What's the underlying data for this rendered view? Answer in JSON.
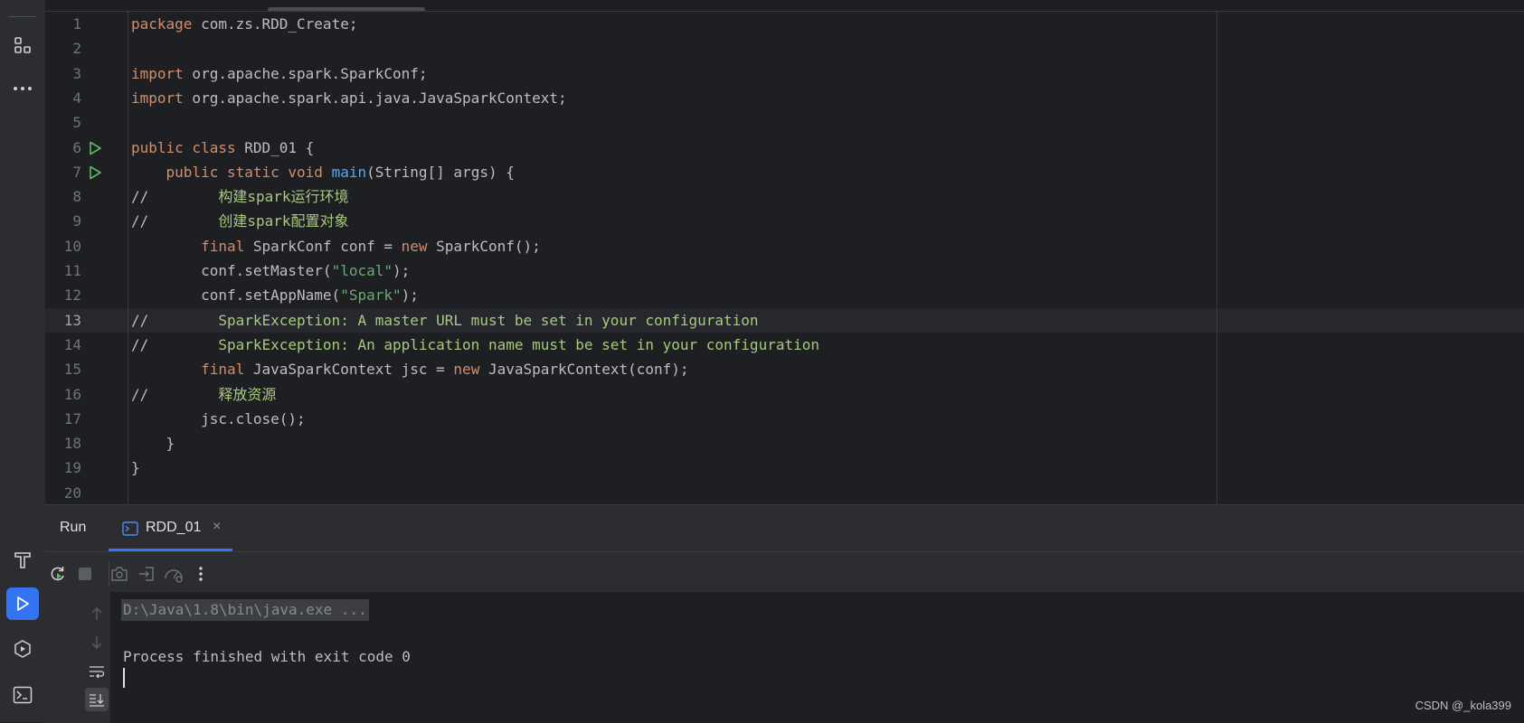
{
  "editor": {
    "lines": [
      {
        "n": "1",
        "tokens": [
          {
            "t": "package",
            "c": "kw"
          },
          {
            "t": " com.zs.RDD_Create;",
            "c": ""
          }
        ]
      },
      {
        "n": "2",
        "tokens": []
      },
      {
        "n": "3",
        "tokens": [
          {
            "t": "import",
            "c": "kw"
          },
          {
            "t": " org.apache.spark.SparkConf;",
            "c": ""
          }
        ]
      },
      {
        "n": "4",
        "tokens": [
          {
            "t": "import",
            "c": "kw"
          },
          {
            "t": " org.apache.spark.api.java.JavaSparkContext;",
            "c": ""
          }
        ]
      },
      {
        "n": "5",
        "tokens": []
      },
      {
        "n": "6",
        "run": true,
        "tokens": [
          {
            "t": "public class",
            "c": "kw"
          },
          {
            "t": " RDD_01 {",
            "c": ""
          }
        ]
      },
      {
        "n": "7",
        "run": true,
        "tokens": [
          {
            "t": "    ",
            "c": ""
          },
          {
            "t": "public static void",
            "c": "kw"
          },
          {
            "t": " ",
            "c": ""
          },
          {
            "t": "main",
            "c": "fn"
          },
          {
            "t": "(String[] args) {",
            "c": ""
          }
        ]
      },
      {
        "n": "8",
        "tokens": [
          {
            "t": "//",
            "c": ""
          },
          {
            "t": "        构建spark运行环境",
            "c": "cmt"
          }
        ]
      },
      {
        "n": "9",
        "tokens": [
          {
            "t": "//",
            "c": ""
          },
          {
            "t": "        创建spark配置对象",
            "c": "cmt"
          }
        ]
      },
      {
        "n": "10",
        "tokens": [
          {
            "t": "        ",
            "c": ""
          },
          {
            "t": "final",
            "c": "kw"
          },
          {
            "t": " SparkConf conf = ",
            "c": ""
          },
          {
            "t": "new",
            "c": "kw"
          },
          {
            "t": " SparkConf();",
            "c": ""
          }
        ]
      },
      {
        "n": "11",
        "tokens": [
          {
            "t": "        conf.setMaster(",
            "c": ""
          },
          {
            "t": "\"local\"",
            "c": "str"
          },
          {
            "t": ");",
            "c": ""
          }
        ]
      },
      {
        "n": "12",
        "tokens": [
          {
            "t": "        conf.setAppName(",
            "c": ""
          },
          {
            "t": "\"Spark\"",
            "c": "str"
          },
          {
            "t": ");",
            "c": ""
          }
        ]
      },
      {
        "n": "13",
        "current": true,
        "tokens": [
          {
            "t": "//",
            "c": ""
          },
          {
            "t": "        SparkException: A master URL must be set in your configuration",
            "c": "cmt"
          }
        ]
      },
      {
        "n": "14",
        "tokens": [
          {
            "t": "//",
            "c": ""
          },
          {
            "t": "        SparkException: An application name must be set in your configuration",
            "c": "cmt"
          }
        ]
      },
      {
        "n": "15",
        "tokens": [
          {
            "t": "        ",
            "c": ""
          },
          {
            "t": "final",
            "c": "kw"
          },
          {
            "t": " JavaSparkContext jsc = ",
            "c": ""
          },
          {
            "t": "new",
            "c": "kw"
          },
          {
            "t": " JavaSparkContext(conf);",
            "c": ""
          }
        ]
      },
      {
        "n": "16",
        "tokens": [
          {
            "t": "//",
            "c": ""
          },
          {
            "t": "        释放资源",
            "c": "cmt"
          }
        ]
      },
      {
        "n": "17",
        "tokens": [
          {
            "t": "        jsc.close();",
            "c": ""
          }
        ]
      },
      {
        "n": "18",
        "tokens": [
          {
            "t": "    }",
            "c": ""
          }
        ]
      },
      {
        "n": "19",
        "tokens": [
          {
            "t": "}",
            "c": ""
          }
        ]
      },
      {
        "n": "20",
        "tokens": []
      }
    ]
  },
  "run_panel": {
    "title": "Run",
    "tab_label": "RDD_01",
    "tab_close": "×",
    "console": {
      "command": "D:\\Java\\1.8\\bin\\java.exe ...",
      "exit_message": "Process finished with exit code 0"
    }
  },
  "watermark": "CSDN @_kola399",
  "colors": {
    "accent": "#3574f0",
    "keyword": "#cf8e6d",
    "function": "#56a8f5",
    "string": "#6aab73",
    "comment": "#a8c97f",
    "run_icon": "#5fb865"
  }
}
